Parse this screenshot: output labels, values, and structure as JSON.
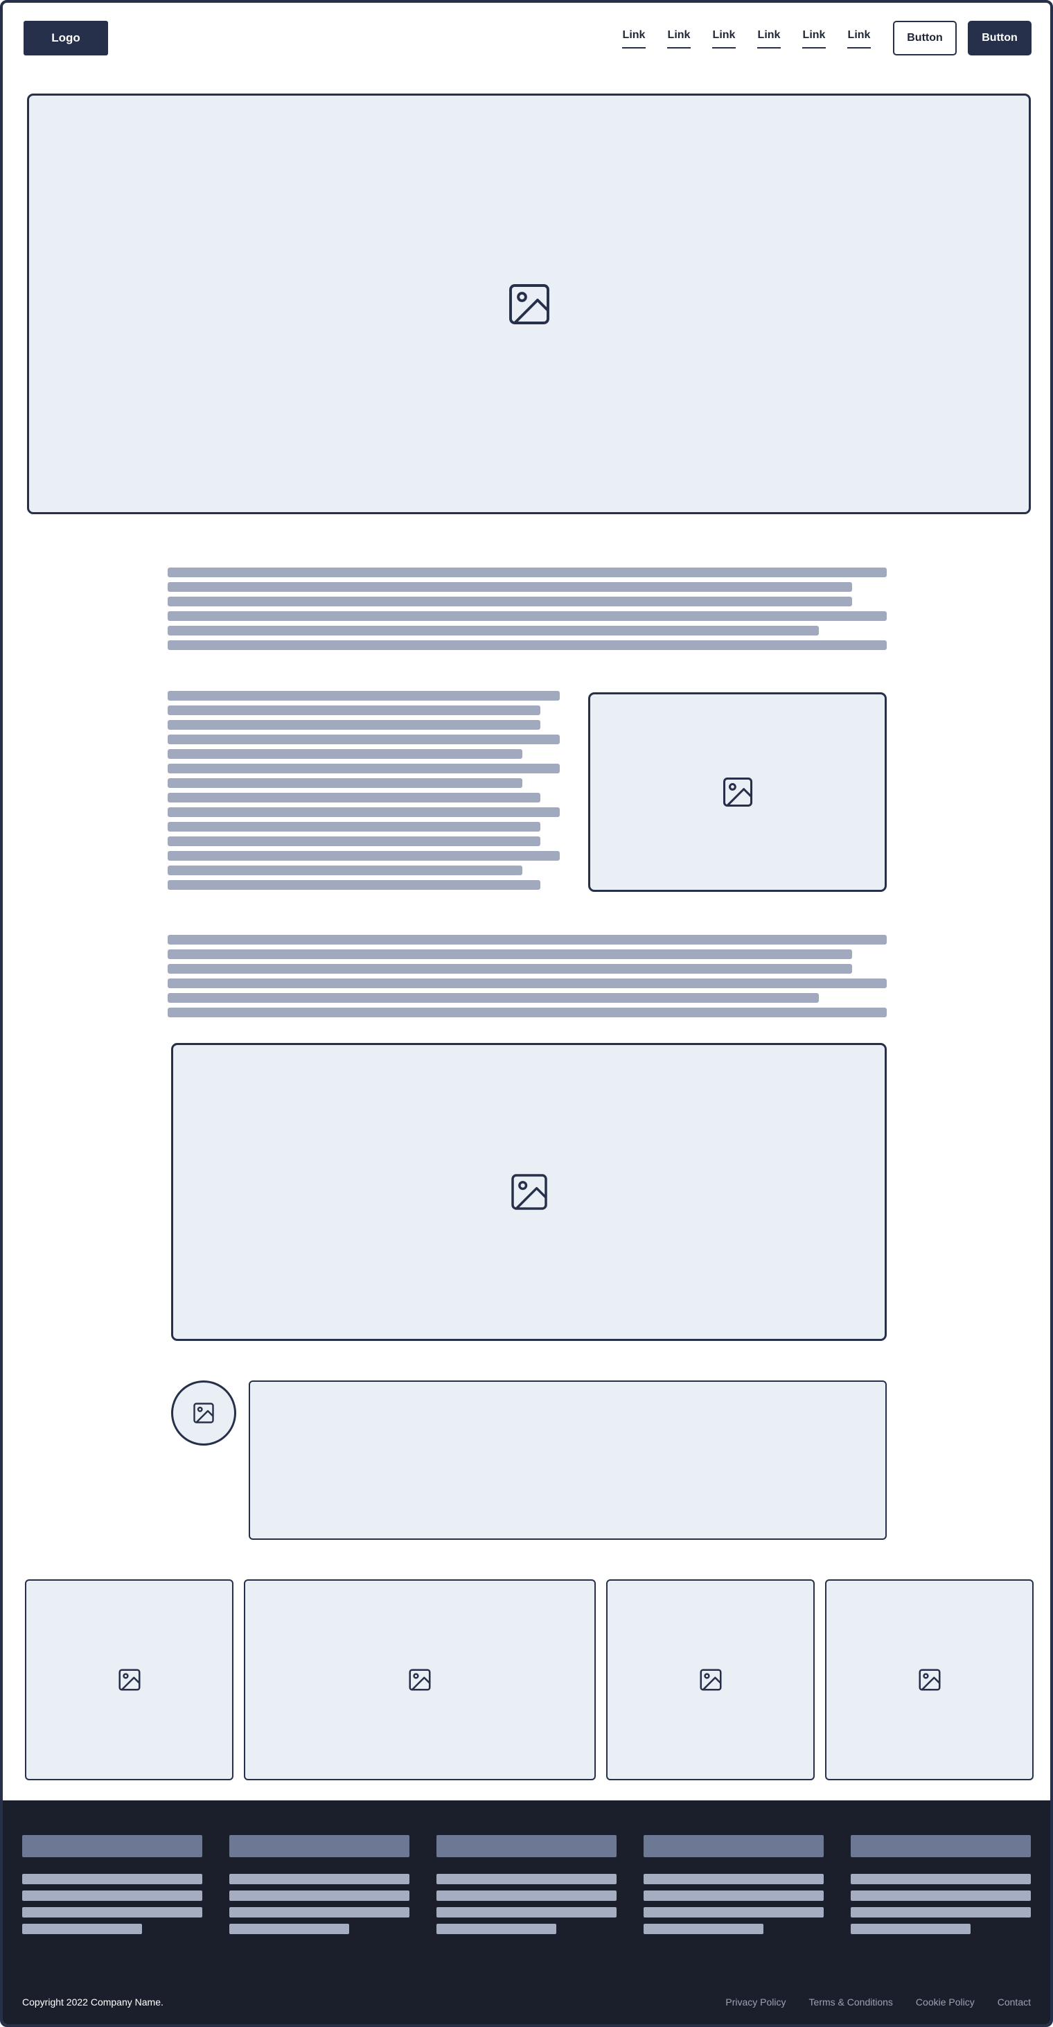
{
  "header": {
    "logo": "Logo",
    "nav": [
      "Link",
      "Link",
      "Link",
      "Link",
      "Link",
      "Link"
    ],
    "button_outline": "Button",
    "button_solid": "Button"
  },
  "footer": {
    "copyright": "Copyright 2022 Company Name.",
    "links": [
      "Privacy Policy",
      "Terms & Conditions",
      "Cookie Policy",
      "Contact"
    ]
  },
  "colors": {
    "dark": "#27304a",
    "placeholder_fill": "#eaeef5",
    "text_line": "#a0a9bd",
    "footer_bg": "#1b1f2b"
  },
  "icons": [
    "image-icon"
  ]
}
